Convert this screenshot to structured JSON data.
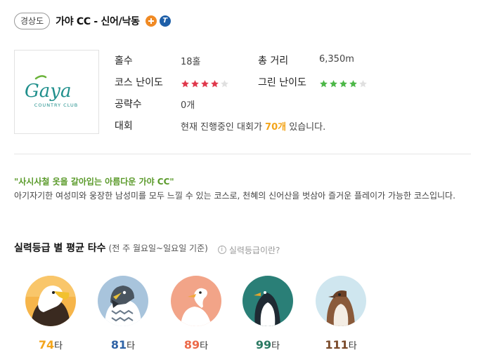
{
  "header": {
    "region": "경상도",
    "title": "가야 CC - 신어/낙동",
    "t_icon": "T",
    "plus_icon": "plus-badge-icon"
  },
  "logo": {
    "brand": "Gaya",
    "subtitle": "COUNTRY CLUB"
  },
  "info": {
    "holes_label": "홀수",
    "holes_value": "18홀",
    "distance_label": "총 거리",
    "distance_value": "6,350m",
    "course_difficulty_label": "코스 난이도",
    "course_difficulty": 4,
    "green_difficulty_label": "그린 난이도",
    "green_difficulty": 4,
    "stars_max": 5,
    "tips_label": "공략수",
    "tips_value": "0개",
    "tournament_label": "대회",
    "tournament_prefix": "현재 진행중인 대회가 ",
    "tournament_count": "70개",
    "tournament_suffix": " 있습니다."
  },
  "description": {
    "quote": "\"사시사철 옷을 갈아입는 아름다운 가야 CC\"",
    "text": "아기자기한 여성미와 웅장한 남성미를 모두 느낄 수 있는 코스로, 천혜의 신어산을 벗삼아 즐거운 플레이가 가능한 코스입니다."
  },
  "skill_section": {
    "title": "실력등급 별 평균 타수",
    "subtitle": "(전 주 월요일~일요일 기준)",
    "help_icon": "i",
    "help_text": "실력등급이란?",
    "unit": "타",
    "levels": [
      {
        "bird": "eagle",
        "score": "74",
        "color": "#f3a51b"
      },
      {
        "bird": "falcon",
        "score": "81",
        "color": "#2f63a6"
      },
      {
        "bird": "swan",
        "score": "89",
        "color": "#ec6a4a"
      },
      {
        "bird": "penguin",
        "score": "99",
        "color": "#2b7a63"
      },
      {
        "bird": "sparrow",
        "score": "111",
        "color": "#7a4a2a"
      }
    ]
  },
  "colors": {
    "star_red": "#e0384c",
    "star_green": "#4db848",
    "star_empty": "#e0e0e0",
    "highlight": "#f3a51b",
    "quote_green": "#5a9a2a"
  }
}
